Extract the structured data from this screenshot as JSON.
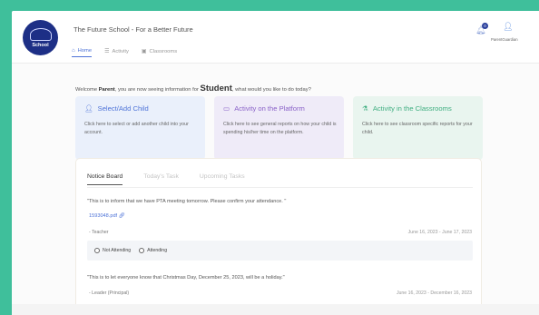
{
  "header": {
    "logo_text": "School",
    "school_title": "The Future School - For a Better Future",
    "nav": [
      {
        "label": "Home",
        "icon": "home-icon"
      },
      {
        "label": "Activity",
        "icon": "activity-icon"
      },
      {
        "label": "Classrooms",
        "icon": "classroom-icon"
      }
    ],
    "notifications_badge": "0",
    "user_name": "ParentGuardian"
  },
  "welcome": {
    "prefix": "Welcome ",
    "role": "Parent",
    "middle": ", you are now seeing information for ",
    "student": "Student",
    "suffix": ", what would you like to do today?"
  },
  "cards": [
    {
      "title": "Select/Add Child",
      "icon": "person-icon",
      "desc": "Click here to select or add another child into your account."
    },
    {
      "title": "Activity on the Platform",
      "icon": "monitor-icon",
      "desc": "Click here to see general reports on how your child is spending his/her time on the platform."
    },
    {
      "title": "Activity in the Classrooms",
      "icon": "flask-icon",
      "desc": "Click here to see classroom specific reports for your child."
    }
  ],
  "notice_board": {
    "tabs": [
      "Notice Board",
      "Today's Task",
      "Upcoming Tasks"
    ],
    "notices": [
      {
        "message": "\"This is to inform that we have PTA meeting tomorrow. Please confirm your attendance. \"",
        "attachment": "1593048.pdf",
        "from": "- Teacher",
        "dates": "June 16, 2023 - June 17, 2023",
        "options": [
          "Not Attending",
          "Attending"
        ]
      },
      {
        "message": "\"This is to let everyone know that Christmas Day, December 25, 2023, will be a holiday.\"",
        "from": "- Leader (Principal)",
        "dates": "June 16, 2023 - December 16, 2023"
      }
    ]
  },
  "colors": {
    "background": "#3fbf9b",
    "accent_blue": "#4f74d8",
    "accent_purple": "#8a62c8",
    "accent_green": "#3fae80",
    "logo_navy": "#1d2f86"
  }
}
